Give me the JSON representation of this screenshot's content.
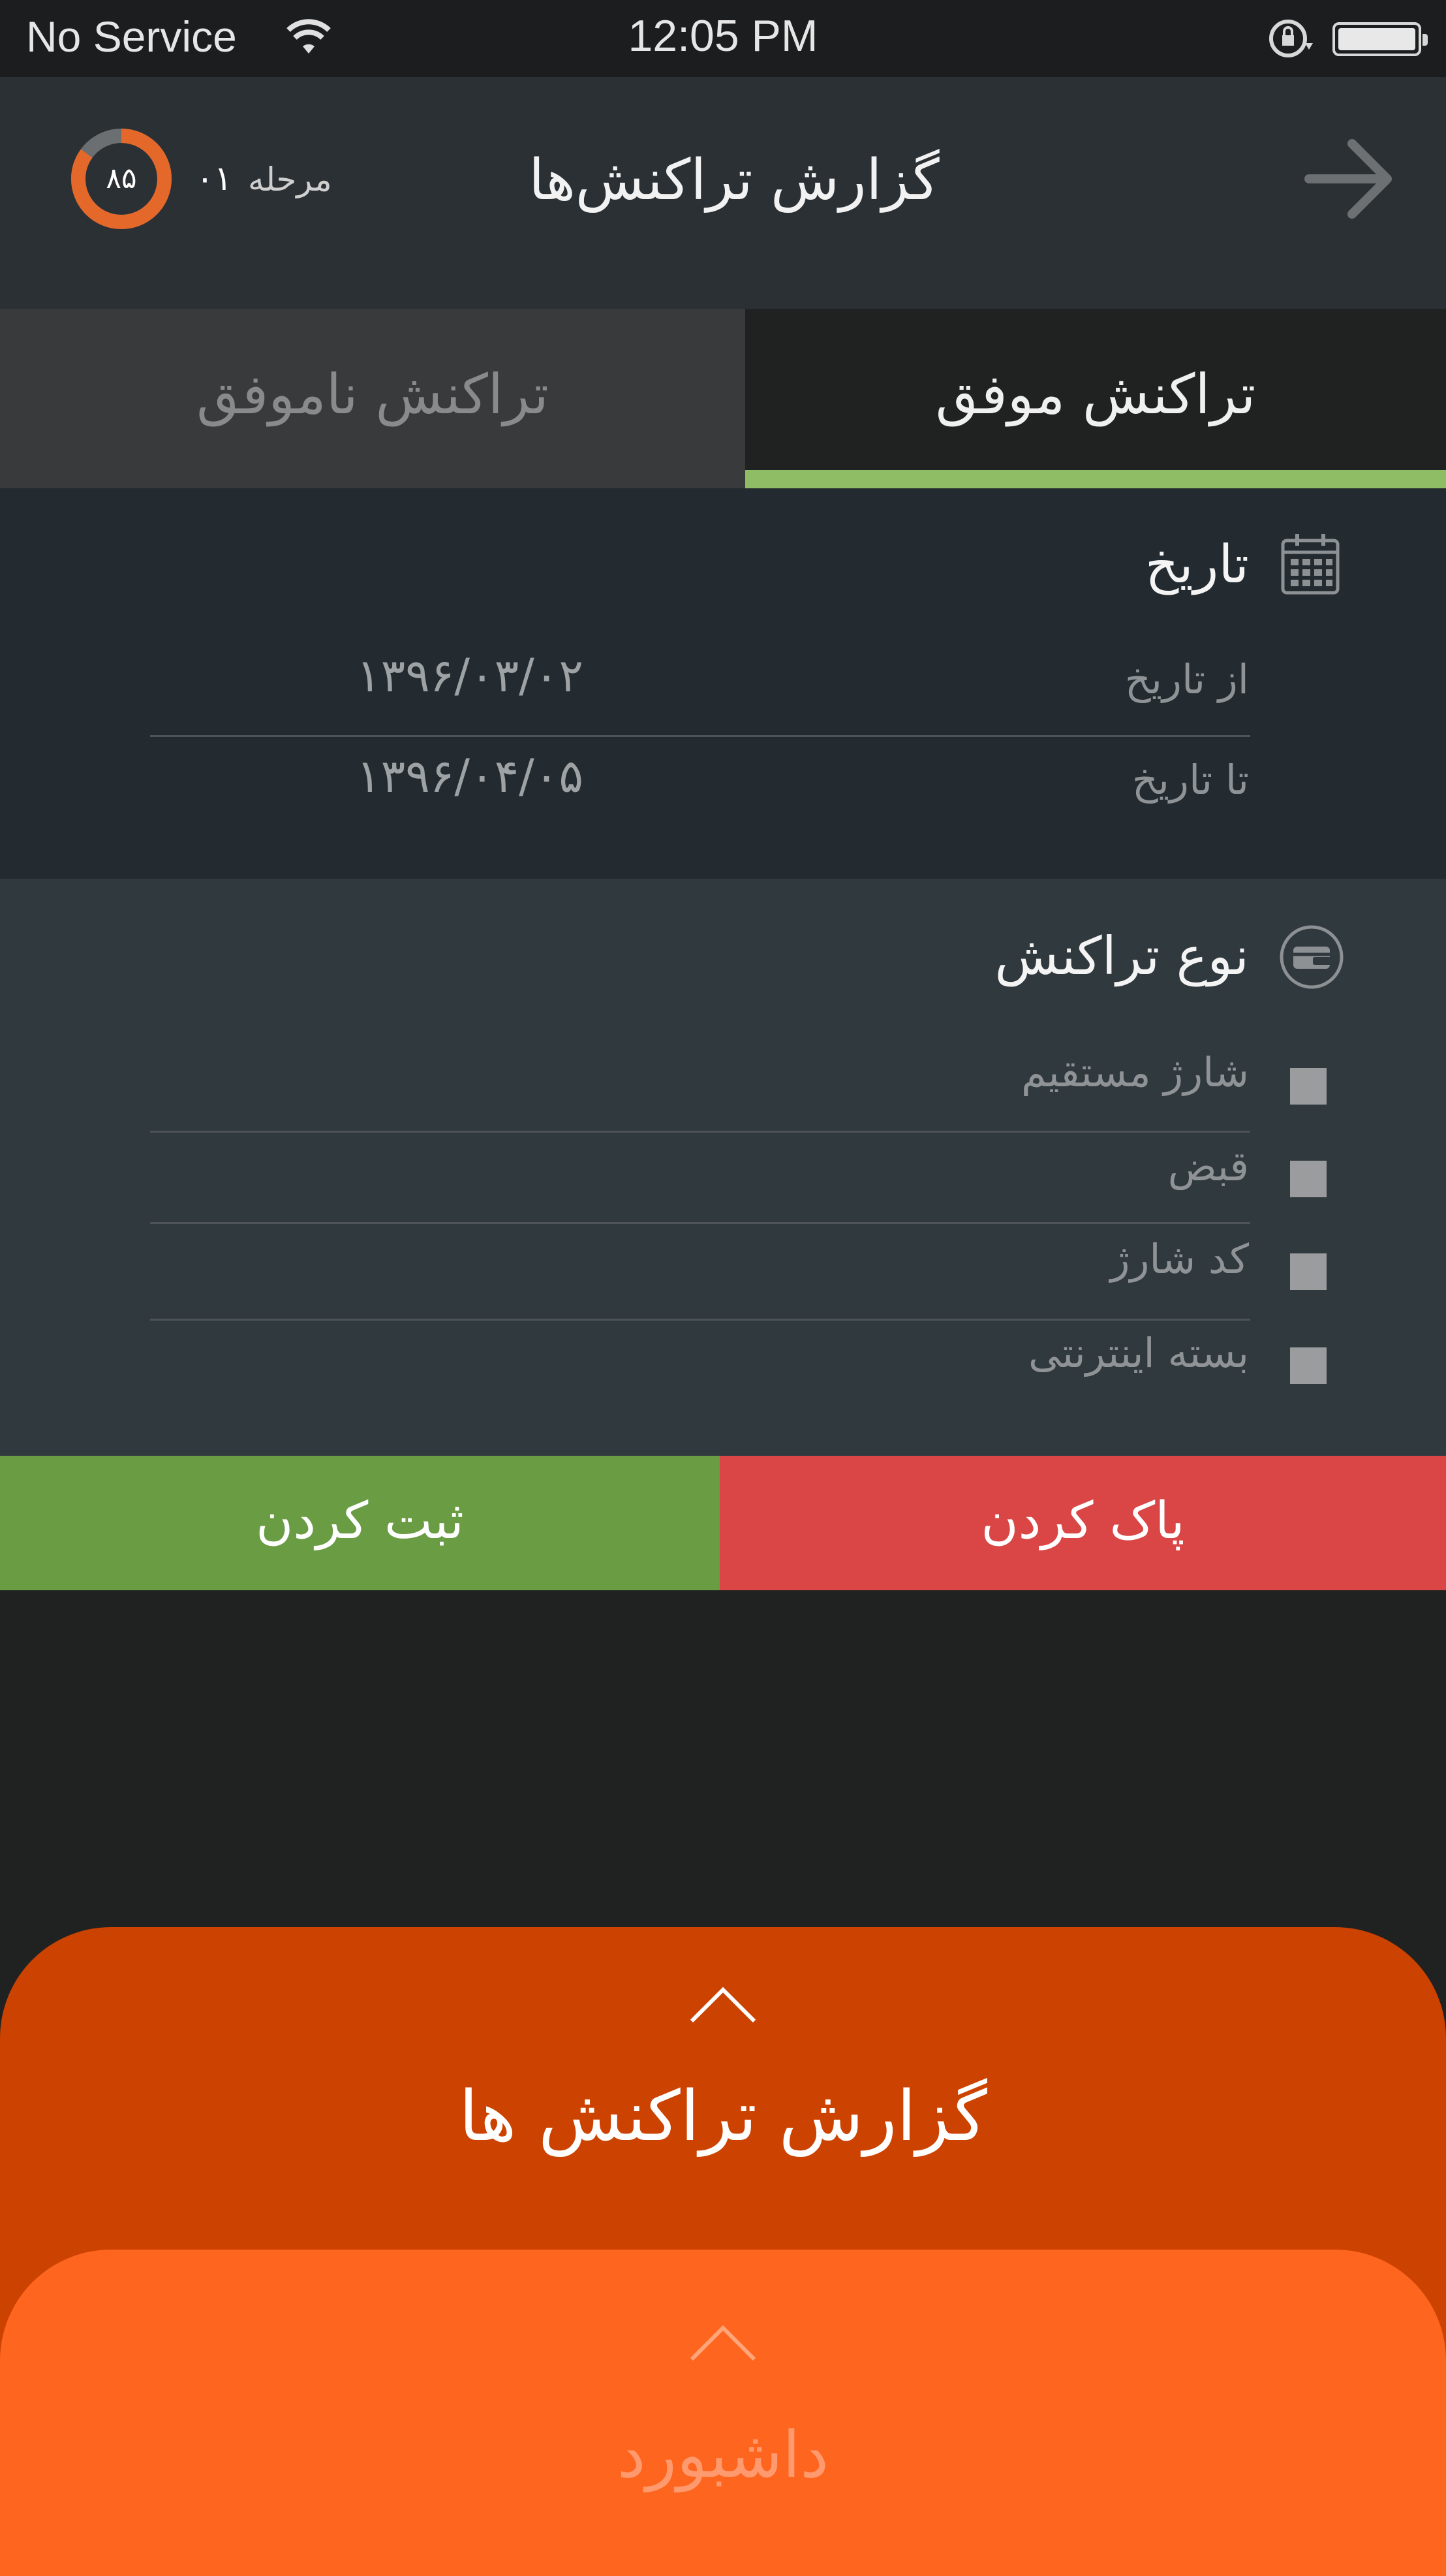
{
  "status_bar": {
    "carrier": "No Service",
    "time": "12:05 PM",
    "wifi_icon": "wifi-icon",
    "lock_icon": "rotation-lock-icon",
    "battery_icon": "battery-icon"
  },
  "header": {
    "title": "گزارش تراکنش‌ها",
    "back_icon": "arrow-right-icon",
    "progress_value": "۸۵",
    "progress_fraction": 0.85,
    "stage_label": "مرحله",
    "stage_number": "۰۱"
  },
  "tabs": {
    "successful": "تراکنش موفق",
    "failed": "تراکنش ناموفق",
    "active": "successful",
    "active_color": "#8ebd65"
  },
  "date_section": {
    "title": "تاریخ",
    "icon": "calendar-icon",
    "from_label": "از تاریخ",
    "from_value": "۱۳۹۶/۰۳/۰۲",
    "to_label": "تا تاریخ",
    "to_value": "۱۳۹۶/۰۴/۰۵"
  },
  "type_section": {
    "title": "نوع تراکنش",
    "icon": "wallet-icon",
    "options": [
      {
        "label": "شارژ مستقیم",
        "checked": false
      },
      {
        "label": "قبض",
        "checked": false
      },
      {
        "label": "کد شارژ",
        "checked": false
      },
      {
        "label": "بسته اینترنتی",
        "checked": false
      }
    ]
  },
  "actions": {
    "save": "ثبت کردن",
    "clear": "پاک کردن",
    "save_color": "#6a9c43",
    "clear_color": "#da4545"
  },
  "bottom_nav": {
    "report": "گزارش تراکنش ها",
    "dashboard": "داشبورد",
    "chevron_icon": "chevron-up-icon",
    "report_color": "#cc4200",
    "dashboard_color": "#fe651e"
  }
}
